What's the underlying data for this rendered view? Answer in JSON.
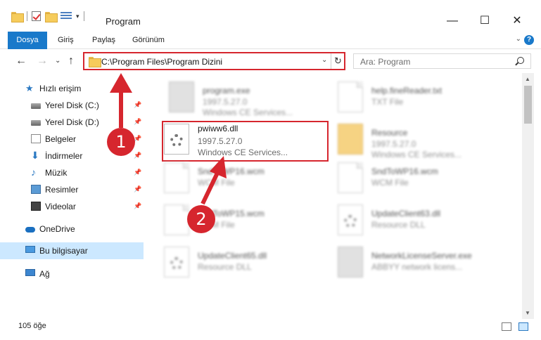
{
  "window": {
    "title": "Program",
    "minimize": "—",
    "maximize": "☐",
    "close": "✕"
  },
  "ribbon": {
    "tabs": [
      "Dosya",
      "Giriş",
      "Paylaş",
      "Görünüm"
    ],
    "expand": "⌄",
    "help": "?"
  },
  "nav": {
    "back": "←",
    "forward": "→",
    "recent": "⌄",
    "up": "↑",
    "address": "C:\\Program Files\\Program Dizini",
    "address_dropdown": "⌄",
    "refresh": "↻",
    "search_placeholder": "Ara: Program"
  },
  "sidebar": {
    "items": [
      {
        "label": "Hızlı erişim",
        "icon": "star-icon",
        "pinned": false
      },
      {
        "label": "Yerel Disk (C:)",
        "icon": "disk-icon",
        "pinned": true
      },
      {
        "label": "Yerel Disk (D:)",
        "icon": "disk-icon",
        "pinned": true
      },
      {
        "label": "Belgeler",
        "icon": "document-icon",
        "pinned": true
      },
      {
        "label": "İndirmeler",
        "icon": "download-icon",
        "pinned": true
      },
      {
        "label": "Müzik",
        "icon": "music-icon",
        "pinned": true
      },
      {
        "label": "Resimler",
        "icon": "pictures-icon",
        "pinned": true
      },
      {
        "label": "Videolar",
        "icon": "video-icon",
        "pinned": true
      },
      {
        "label": "OneDrive",
        "icon": "cloud-icon",
        "pinned": false
      },
      {
        "label": "Bu bilgisayar",
        "icon": "computer-icon",
        "pinned": false
      },
      {
        "label": "Ağ",
        "icon": "network-icon",
        "pinned": false
      }
    ],
    "pin_glyph": "📌"
  },
  "files": [
    {
      "name": "program.exe",
      "line1": "1997.5.27.0",
      "line2": "Windows CE Services...",
      "icon": "exe-icon"
    },
    {
      "name": "help.fineReader.txt",
      "line1": "TXT File",
      "line2": "",
      "icon": "text-file-icon"
    },
    {
      "name": "pwiww6.dll",
      "line1": "1997.5.27.0",
      "line2": "Windows CE Services...",
      "icon": "dll-gear-icon"
    },
    {
      "name": "Resource",
      "line1": "1997.5.27.0",
      "line2": "Windows CE Services...",
      "icon": "folder-icon"
    },
    {
      "name": "SndToWP16.wcm",
      "line1": "WCM File",
      "line2": "",
      "icon": "file-icon"
    },
    {
      "name": "SndToWP16.wcm",
      "line1": "WCM File",
      "line2": "",
      "icon": "file-icon"
    },
    {
      "name": "SndToWP15.wcm",
      "line1": "WCM File",
      "line2": "",
      "icon": "file-icon"
    },
    {
      "name": "UpdateClient63.dll",
      "line1": "Resource DLL",
      "line2": "",
      "icon": "dll-gear-icon"
    },
    {
      "name": "UpdateClient65.dll",
      "line1": "Resource DLL",
      "line2": "",
      "icon": "dll-gear-icon"
    },
    {
      "name": "NetworkLicenseServer.exe",
      "line1": "ABBYY network licens...",
      "line2": "",
      "icon": "exe-icon"
    }
  ],
  "annotations": [
    "1",
    "2"
  ],
  "status": {
    "count": "105 öğe"
  },
  "colors": {
    "accent": "#1979ca",
    "highlight_red": "#d6262e",
    "selection": "#cce8ff"
  }
}
